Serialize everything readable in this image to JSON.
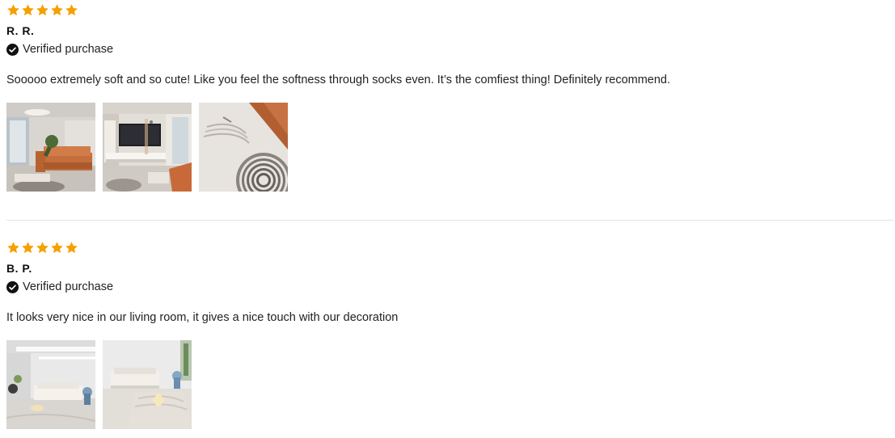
{
  "colors": {
    "star": "#f5a000",
    "text": "#222222",
    "divider": "#e3e3e3",
    "check": "#111111"
  },
  "icons": {
    "star": "star-icon",
    "verified": "check-circle-icon"
  },
  "reviews": [
    {
      "rating": 5,
      "author": "R. R.",
      "verified_label": "Verified purchase",
      "text": "Sooooo extremely soft and so cute! Like you feel the softness through socks even. It’s the comfiest thing! Definitely recommend.",
      "photo_count": 3
    },
    {
      "rating": 5,
      "author": "B. P.",
      "verified_label": "Verified purchase",
      "text": "It looks very nice in our living room, it gives a nice touch with our decoration",
      "photo_count": 2
    }
  ]
}
